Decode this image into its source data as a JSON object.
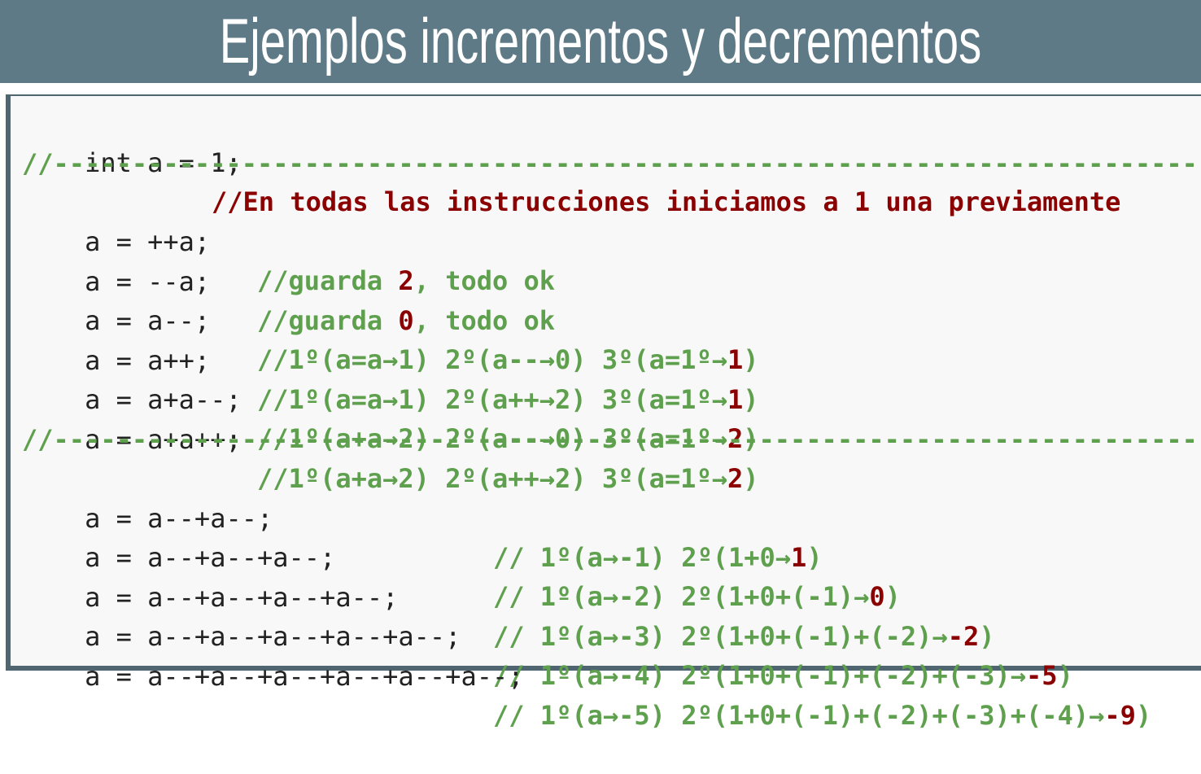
{
  "title": "Ejemplos incrementos y decrementos",
  "colors": {
    "banner": "#5f7a87",
    "comment": "#5fa04e",
    "result": "#8b0000",
    "code": "#222222"
  },
  "header_line": {
    "code": "int a = 1;",
    "comment": "//En todas las instrucciones iniciamos a 1 una previamente"
  },
  "separator": "//-------------------------------------------------------------------------",
  "group1": [
    {
      "code": "a = ++a;",
      "comment": "//guarda ",
      "result": "2",
      "tail": ", todo ok"
    },
    {
      "code": "a = --a;",
      "comment": "//guarda ",
      "result": "0",
      "tail": ", todo ok"
    },
    {
      "code": "a = a--;",
      "comment": "//1º(a=a→1) 2º(a--→0) 3º(a=1º→",
      "result": "1",
      "tail": ")"
    },
    {
      "code": "a = a++;",
      "comment": "//1º(a=a→1) 2º(a++→2) 3º(a=1º→",
      "result": "1",
      "tail": ")"
    },
    {
      "code": "a = a+a--;",
      "comment": "//1º(a+a→2) 2º(a--→0) 3º(a=1º→",
      "result": "2",
      "tail": ")"
    },
    {
      "code": "a = a+a++;",
      "comment": "//1º(a+a→2) 2º(a++→2) 3º(a=1º→",
      "result": "2",
      "tail": ")"
    }
  ],
  "group2": [
    {
      "code": "a = a--+a--;",
      "comment": "// 1º(a→-1) 2º(1+0→",
      "result": "1",
      "tail": ")"
    },
    {
      "code": "a = a--+a--+a--;",
      "comment": "// 1º(a→-2) 2º(1+0+(-1)→",
      "result": "0",
      "tail": ")"
    },
    {
      "code": "a = a--+a--+a--+a--;",
      "comment": "// 1º(a→-3) 2º(1+0+(-1)+(-2)→",
      "result": "-2",
      "tail": ")"
    },
    {
      "code": "a = a--+a--+a--+a--+a--;",
      "comment": "// 1º(a→-4) 2º(1+0+(-1)+(-2)+(-3)→",
      "result": "-5",
      "tail": ")"
    },
    {
      "code": "a = a--+a--+a--+a--+a--+a--;",
      "comment": "// 1º(a→-5) 2º(1+0+(-1)+(-2)+(-3)+(-4)→",
      "result": "-9",
      "tail": ")"
    }
  ]
}
